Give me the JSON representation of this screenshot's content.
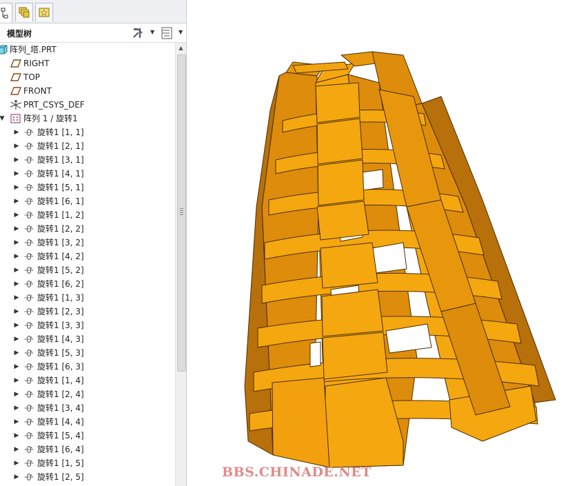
{
  "header": {
    "title": "模型树"
  },
  "tree": {
    "root": {
      "label": "阵列_塔.PRT"
    },
    "datums": [
      {
        "label": "RIGHT"
      },
      {
        "label": "TOP"
      },
      {
        "label": "FRONT"
      }
    ],
    "csys": {
      "label": "PRT_CSYS_DEF"
    },
    "pattern": {
      "label": "阵列 1 / 旋转1"
    },
    "members": [
      "旋转1 [1, 1]",
      "旋转1 [2, 1]",
      "旋转1 [3, 1]",
      "旋转1 [4, 1]",
      "旋转1 [5, 1]",
      "旋转1 [6, 1]",
      "旋转1 [1, 2]",
      "旋转1 [2, 2]",
      "旋转1 [3, 2]",
      "旋转1 [4, 2]",
      "旋转1 [5, 2]",
      "旋转1 [6, 2]",
      "旋转1 [1, 3]",
      "旋转1 [2, 3]",
      "旋转1 [3, 3]",
      "旋转1 [4, 3]",
      "旋转1 [5, 3]",
      "旋转1 [6, 3]",
      "旋转1 [1, 4]",
      "旋转1 [2, 4]",
      "旋转1 [3, 4]",
      "旋转1 [4, 4]",
      "旋转1 [5, 4]",
      "旋转1 [6, 4]",
      "旋转1 [1, 5]",
      "旋转1 [2, 5]"
    ]
  },
  "viewport": {
    "watermark": "BBS.CHINADE.NET",
    "model_colors": {
      "light": "#f5a70f",
      "mid": "#dd8c0b",
      "dark": "#b8700a",
      "edge": "#4a2e06"
    }
  }
}
